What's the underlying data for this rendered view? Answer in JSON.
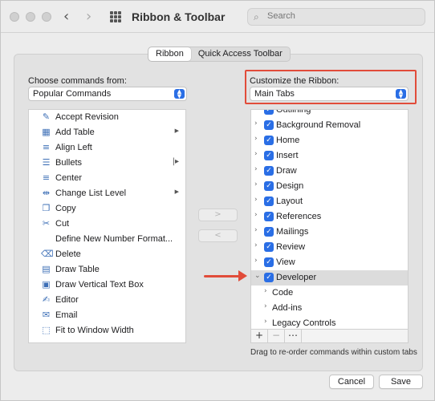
{
  "window": {
    "title": "Ribbon & Toolbar"
  },
  "search": {
    "placeholder": "Search"
  },
  "segments": [
    "Ribbon",
    "Quick Access Toolbar"
  ],
  "left": {
    "label": "Choose commands from:",
    "select_value": "Popular Commands",
    "commands": [
      {
        "label": "Accept Revision",
        "icon": "accept-revision-icon",
        "glyph": "✎",
        "submenu": false
      },
      {
        "label": "Add Table",
        "icon": "table-icon",
        "glyph": "▦",
        "submenu": true
      },
      {
        "label": "Align Left",
        "icon": "align-left-icon",
        "glyph": "≡",
        "submenu": false
      },
      {
        "label": "Bullets",
        "icon": "bullets-icon",
        "glyph": "☰",
        "submenu": false,
        "bar": true
      },
      {
        "label": "Center",
        "icon": "align-center-icon",
        "glyph": "≡",
        "submenu": false
      },
      {
        "label": "Change List Level",
        "icon": "list-level-icon",
        "glyph": "⇹",
        "submenu": true
      },
      {
        "label": "Copy",
        "icon": "copy-icon",
        "glyph": "❐",
        "submenu": false
      },
      {
        "label": "Cut",
        "icon": "scissors-icon",
        "glyph": "✂",
        "submenu": false
      },
      {
        "label": "Define New Number Format...",
        "icon": "",
        "glyph": "",
        "submenu": false
      },
      {
        "label": "Delete",
        "icon": "delete-icon",
        "glyph": "⌫",
        "submenu": false
      },
      {
        "label": "Draw Table",
        "icon": "draw-table-icon",
        "glyph": "▤",
        "submenu": false
      },
      {
        "label": "Draw Vertical Text Box",
        "icon": "vertical-text-box-icon",
        "glyph": "▣",
        "submenu": false
      },
      {
        "label": "Editor",
        "icon": "editor-icon",
        "glyph": "✍",
        "submenu": false
      },
      {
        "label": "Email",
        "icon": "email-icon",
        "glyph": "✉",
        "submenu": false
      },
      {
        "label": "Fit to Window Width",
        "icon": "fit-width-icon",
        "glyph": "⬚",
        "submenu": false
      }
    ]
  },
  "move_buttons": {
    "add": ">",
    "remove": "<"
  },
  "right": {
    "label": "Customize the Ribbon:",
    "select_value": "Main Tabs",
    "tabs": [
      {
        "label": "Outlining",
        "checked": true,
        "level": 0,
        "highlight": false
      },
      {
        "label": "Background Removal",
        "checked": true,
        "level": 0,
        "highlight": false
      },
      {
        "label": "Home",
        "checked": true,
        "level": 0,
        "highlight": false
      },
      {
        "label": "Insert",
        "checked": true,
        "level": 0,
        "highlight": false
      },
      {
        "label": "Draw",
        "checked": true,
        "level": 0,
        "highlight": false
      },
      {
        "label": "Design",
        "checked": true,
        "level": 0,
        "highlight": false
      },
      {
        "label": "Layout",
        "checked": true,
        "level": 0,
        "highlight": false
      },
      {
        "label": "References",
        "checked": true,
        "level": 0,
        "highlight": false
      },
      {
        "label": "Mailings",
        "checked": true,
        "level": 0,
        "highlight": false
      },
      {
        "label": "Review",
        "checked": true,
        "level": 0,
        "highlight": false
      },
      {
        "label": "View",
        "checked": true,
        "level": 0,
        "highlight": false
      },
      {
        "label": "Developer",
        "checked": true,
        "level": 0,
        "highlight": true,
        "expanded": true
      },
      {
        "label": "Code",
        "checked": false,
        "level": 1,
        "highlight": false
      },
      {
        "label": "Add-ins",
        "checked": false,
        "level": 1,
        "highlight": false
      },
      {
        "label": "Legacy Controls",
        "checked": false,
        "level": 1,
        "highlight": false
      }
    ],
    "toolbar": {
      "add": "+",
      "remove": "−",
      "more": "⋯"
    },
    "hint": "Drag to re-order commands within custom tabs"
  },
  "footer": {
    "cancel": "Cancel",
    "save": "Save"
  },
  "colors": {
    "accent": "#2a6ee5",
    "annotation": "#e14c3a"
  }
}
